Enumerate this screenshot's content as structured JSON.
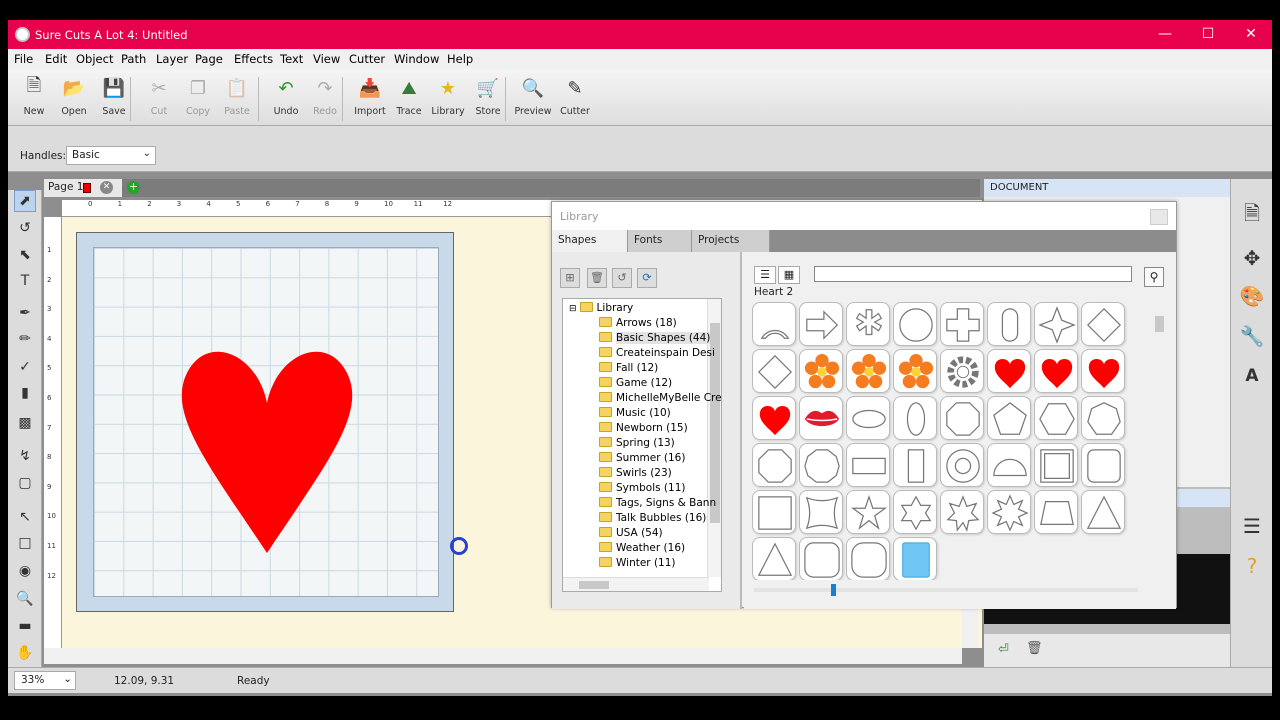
{
  "window": {
    "title": "Sure Cuts A Lot 4: Untitled"
  },
  "menu": [
    "File",
    "Edit",
    "Object",
    "Path",
    "Layer",
    "Page",
    "Effects",
    "Text",
    "View",
    "Cutter",
    "Window",
    "Help"
  ],
  "toolbar": [
    {
      "label": "New",
      "icon": "new-document-icon",
      "enabled": true
    },
    {
      "label": "Open",
      "icon": "open-folder-icon",
      "enabled": true
    },
    {
      "label": "Save",
      "icon": "save-floppy-icon",
      "enabled": true
    },
    {
      "label": "Cut",
      "icon": "scissors-icon",
      "enabled": false
    },
    {
      "label": "Copy",
      "icon": "copy-icon",
      "enabled": false
    },
    {
      "label": "Paste",
      "icon": "paste-icon",
      "enabled": false
    },
    {
      "label": "Undo",
      "icon": "undo-arrow-icon",
      "enabled": true
    },
    {
      "label": "Redo",
      "icon": "redo-arrow-icon",
      "enabled": false
    },
    {
      "label": "Import",
      "icon": "import-svg-icon",
      "enabled": true
    },
    {
      "label": "Trace",
      "icon": "trace-image-icon",
      "enabled": true
    },
    {
      "label": "Library",
      "icon": "library-star-icon",
      "enabled": true
    },
    {
      "label": "Store",
      "icon": "store-cart-icon",
      "enabled": true
    },
    {
      "label": "Preview",
      "icon": "preview-magnifier-icon",
      "enabled": true
    },
    {
      "label": "Cutter",
      "icon": "cutter-blade-icon",
      "enabled": true
    }
  ],
  "options": {
    "handles_label": "Handles:",
    "handles_value": "Basic"
  },
  "page_tab": {
    "label": "Page 1"
  },
  "ruler_ticks": [
    "0",
    "1",
    "2",
    "3",
    "4",
    "5",
    "6",
    "7",
    "8",
    "9",
    "10",
    "11",
    "12"
  ],
  "ruler_ticks_v": [
    "1",
    "2",
    "3",
    "4",
    "5",
    "6",
    "7",
    "8",
    "9",
    "10",
    "11",
    "12"
  ],
  "status": {
    "zoom": "33%",
    "coords": "12.09, 9.31",
    "state": "Ready"
  },
  "right_panel": {
    "doc_header": "DOCUMENT"
  },
  "library": {
    "title": "Library",
    "tabs": [
      "Shapes",
      "Fonts",
      "Projects"
    ],
    "active_tab": "Shapes",
    "selected_shape": "Heart 2",
    "tree": [
      {
        "label": "Library",
        "level": 0
      },
      {
        "label": "Arrows (18)",
        "level": 1
      },
      {
        "label": "Basic Shapes (44)",
        "level": 1,
        "selected": true
      },
      {
        "label": "Createinspain Desi",
        "level": 1
      },
      {
        "label": "Fall (12)",
        "level": 1
      },
      {
        "label": "Game (12)",
        "level": 1
      },
      {
        "label": "MichelleMyBelle Cre",
        "level": 1
      },
      {
        "label": "Music (10)",
        "level": 1
      },
      {
        "label": "Newborn (15)",
        "level": 1
      },
      {
        "label": "Spring (13)",
        "level": 1
      },
      {
        "label": "Summer (16)",
        "level": 1
      },
      {
        "label": "Swirls (23)",
        "level": 1
      },
      {
        "label": "Symbols (11)",
        "level": 1
      },
      {
        "label": "Tags, Signs & Bann",
        "level": 1
      },
      {
        "label": "Talk Bubbles (16)",
        "level": 1
      },
      {
        "label": "USA (54)",
        "level": 1
      },
      {
        "label": "Weather (16)",
        "level": 1
      },
      {
        "label": "Winter (11)",
        "level": 1
      }
    ],
    "shapes": [
      "arch",
      "arrow",
      "asterisk",
      "circle",
      "cross",
      "capsule",
      "four-point-star",
      "diamond",
      "diamond",
      "flower-orange",
      "flower-orange",
      "flower-orange",
      "gear",
      "heart-red",
      "heart-red",
      "heart-red",
      "heart-red",
      "lips",
      "ellipse-h",
      "ellipse-v",
      "octagon",
      "pentagon",
      "hexagon",
      "heptagon",
      "octagon",
      "decagon",
      "rect-h",
      "rect-v",
      "ring",
      "dome",
      "square-frame",
      "rounded-square",
      "square",
      "pillow",
      "star-5",
      "star-6",
      "star-7",
      "star-8",
      "trapezoid",
      "triangle",
      "triangle",
      "rounded-square-lg",
      "rounded-square-xl",
      "blue-tile"
    ]
  },
  "colors": {
    "accent": "#e7004c",
    "heart": "#ff0000",
    "flower": "#f57c1f",
    "tile": "#6ec7f5"
  }
}
